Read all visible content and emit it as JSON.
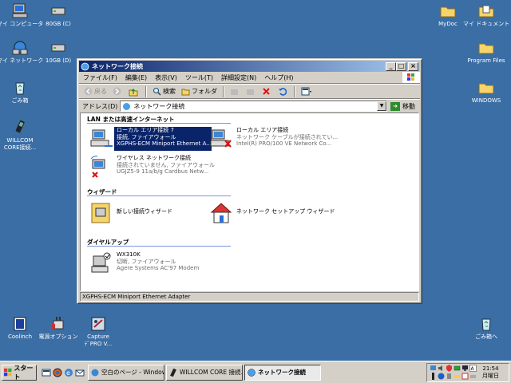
{
  "desktop": {
    "icons_left": [
      {
        "label": "マイ コンピュータ",
        "icon": "my-computer-icon"
      },
      {
        "label": "80GB (C)",
        "icon": "drive-icon"
      },
      {
        "label": "マイ ネットワーク",
        "icon": "network-places-icon"
      },
      {
        "label": "10GB (D)",
        "icon": "drive-icon"
      },
      {
        "label": "ごみ箱",
        "icon": "recycle-bin-icon"
      },
      {
        "label": "WILLCOM",
        "label2": "CORE接続...",
        "icon": "willcom-icon"
      },
      {
        "label": "Coolinch",
        "icon": "coolinch-icon"
      },
      {
        "label": "電源オプション",
        "icon": "power-options-icon"
      },
      {
        "label": "Capture",
        "label2": "ﾃﾞPRO V...",
        "icon": "capture-icon"
      }
    ],
    "icons_right": [
      {
        "label": "MyDoc",
        "icon": "folder-icon"
      },
      {
        "label": "マイ ドキュメント",
        "icon": "my-documents-icon"
      },
      {
        "label": "Program Files",
        "icon": "folder-icon"
      },
      {
        "label": "WINDOWS",
        "icon": "folder-icon"
      },
      {
        "label": "ごみ箱へ",
        "icon": "recycle-bin-icon"
      }
    ]
  },
  "window": {
    "title": "ネットワーク接続",
    "menu": [
      "ファイル(F)",
      "編集(E)",
      "表示(V)",
      "ツール(T)",
      "詳細設定(N)",
      "ヘルプ(H)"
    ],
    "toolbar": {
      "back": "戻る",
      "search": "検索",
      "folders": "フォルダ"
    },
    "address": {
      "label": "アドレス(D)",
      "value": "ネットワーク接続",
      "go": "移動"
    },
    "groups": [
      {
        "title": "LAN または高速インターネット"
      },
      {
        "title": "ウィザード"
      },
      {
        "title": "ダイヤルアップ"
      }
    ],
    "items": [
      {
        "name": "ローカル エリア接続 7",
        "status": "接続, ファイアウォール",
        "device": "XGPHS-ECM Miniport Ethernet A..."
      },
      {
        "name": "ローカル エリア接続",
        "status": "ネットワーク ケーブルが接続されてい...",
        "device": "Intel(R) PRO/100 VE Network Co..."
      },
      {
        "name": "ワイヤレス ネットワーク接続",
        "status": "接続されていません, ファイアウォール",
        "device": "UGJZ5-9 11a/b/g Cardbus Netw..."
      },
      {
        "name": "新しい接続ウィザード"
      },
      {
        "name": "ネットワーク セットアップ ウィザード"
      },
      {
        "name": "WX310K",
        "status": "切断, ファイアウォール",
        "device": "Agere Systems AC'97 Modem"
      }
    ],
    "statusbar": "XGPHS-ECM Miniport Ethernet Adapter"
  },
  "taskbar": {
    "start": "スタート",
    "tasks": [
      {
        "label": "空白のページ - Windows ...",
        "icon": "ie-icon"
      },
      {
        "label": "WILLCOM CORE 接続ユ...",
        "icon": "willcom-icon"
      },
      {
        "label": "ネットワーク接続",
        "icon": "network-icon"
      }
    ],
    "clock": {
      "time": "21:54",
      "day": "月曜日"
    }
  }
}
